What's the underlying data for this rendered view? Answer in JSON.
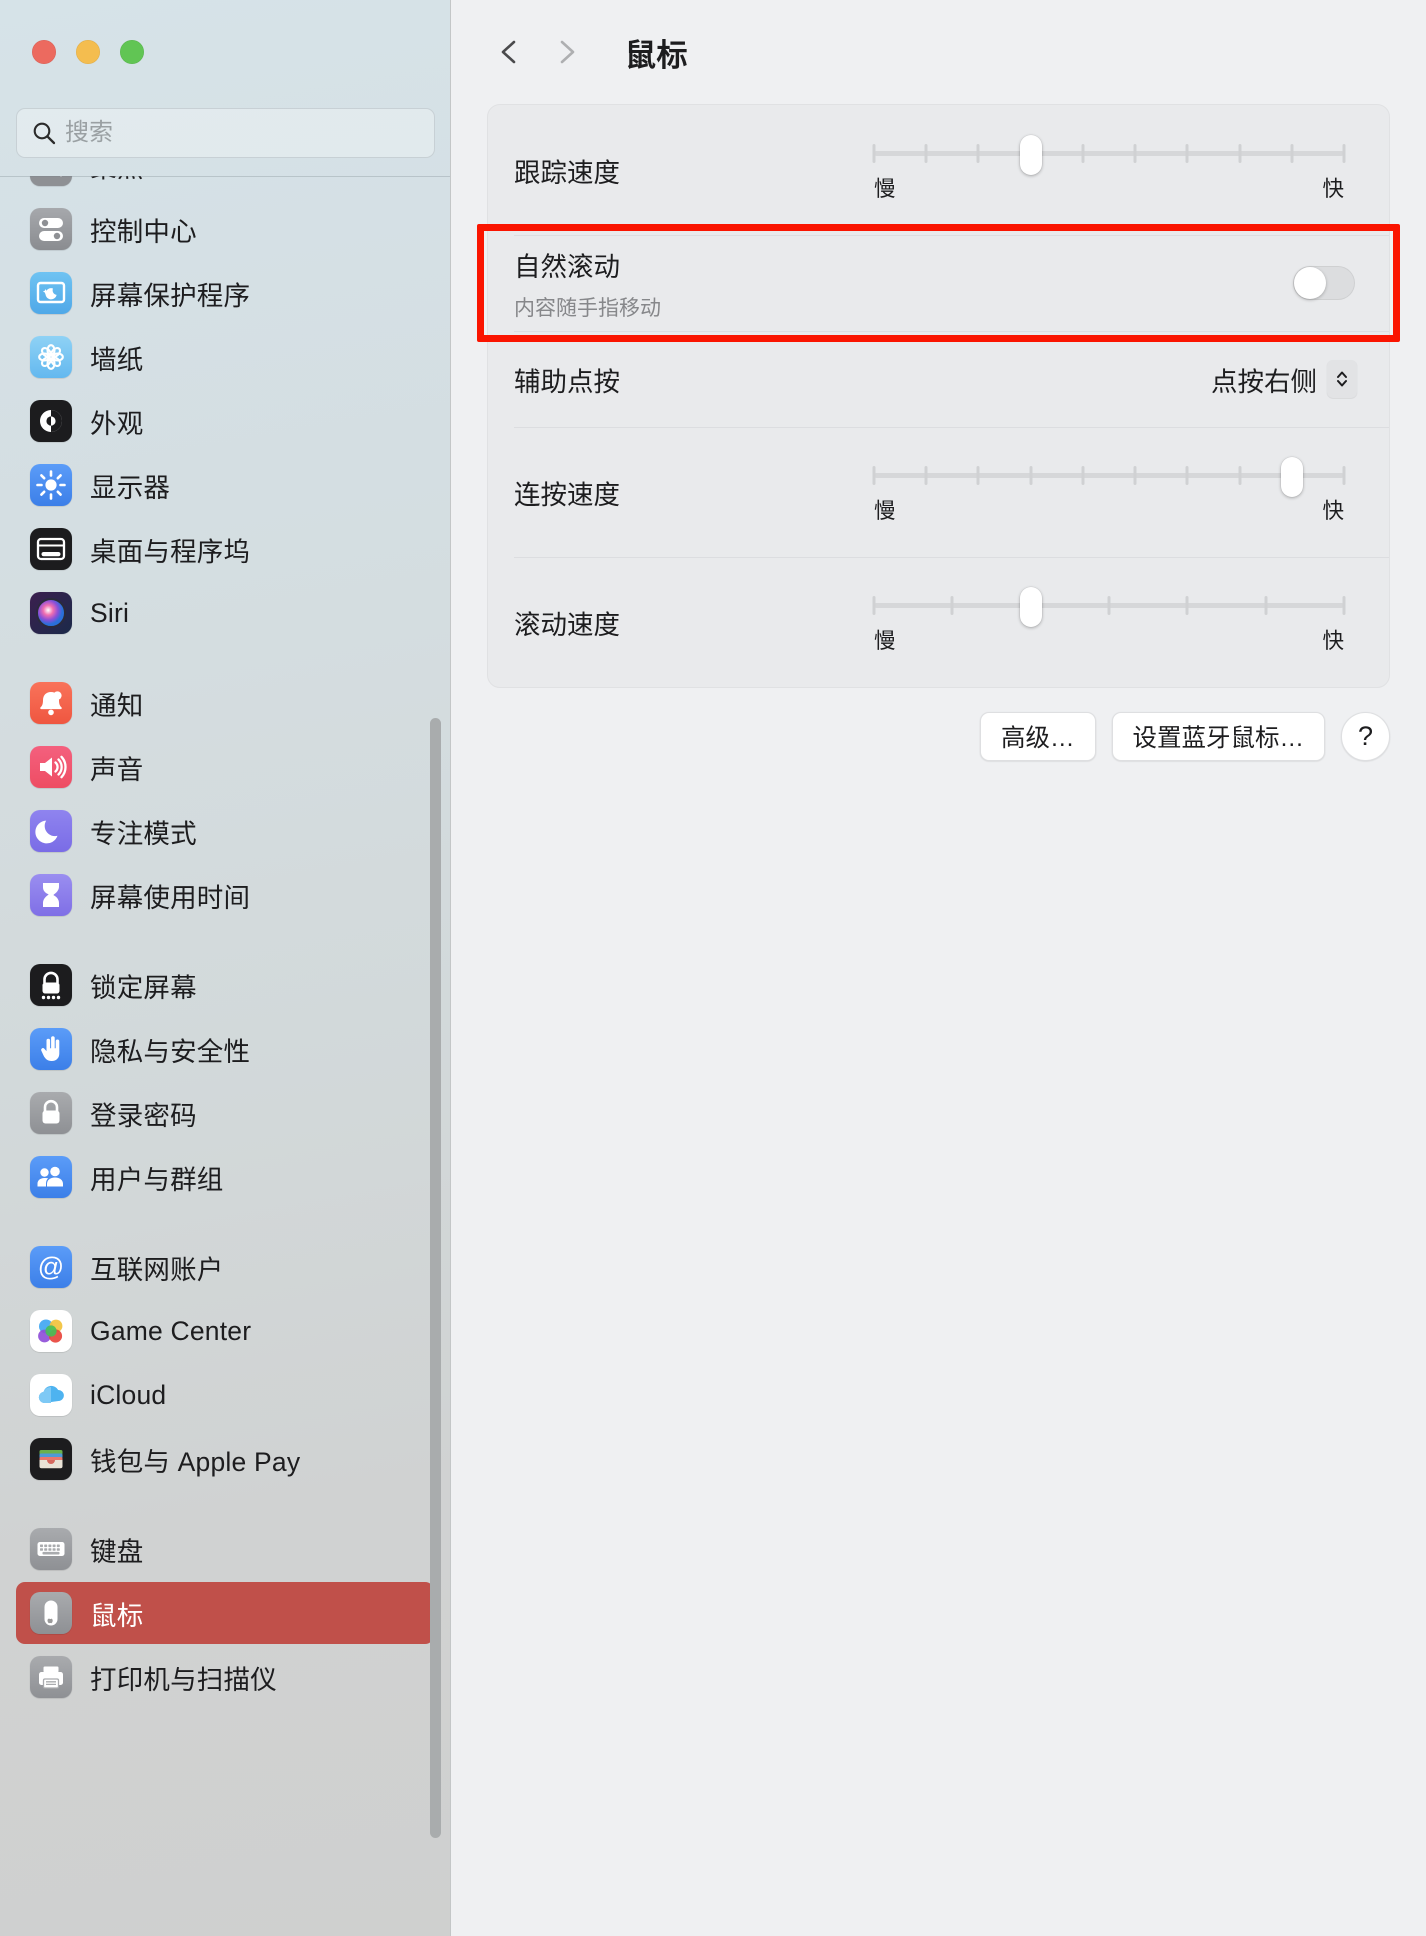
{
  "window": {
    "traffic_lights": [
      "close",
      "minimize",
      "zoom"
    ],
    "accent_color": "#c0504a"
  },
  "sidebar": {
    "search": {
      "placeholder": "搜索",
      "value": "",
      "icon": "search-icon"
    },
    "items": [
      {
        "label": "聚焦",
        "icon": "spotlight-icon",
        "clipped": true,
        "group": 0
      },
      {
        "label": "控制中心",
        "icon": "control-center-icon",
        "group": 0
      },
      {
        "label": "屏幕保护程序",
        "icon": "screen-saver-icon",
        "group": 0
      },
      {
        "label": "墙纸",
        "icon": "wallpaper-icon",
        "group": 0
      },
      {
        "label": "外观",
        "icon": "appearance-icon",
        "group": 0
      },
      {
        "label": "显示器",
        "icon": "displays-icon",
        "group": 0
      },
      {
        "label": "桌面与程序坞",
        "icon": "desktop-dock-icon",
        "group": 0
      },
      {
        "label": "Siri",
        "icon": "siri-icon",
        "group": 0
      },
      {
        "label": "通知",
        "icon": "notifications-icon",
        "group": 1
      },
      {
        "label": "声音",
        "icon": "sound-icon",
        "group": 1
      },
      {
        "label": "专注模式",
        "icon": "focus-icon",
        "group": 1
      },
      {
        "label": "屏幕使用时间",
        "icon": "screen-time-icon",
        "group": 1
      },
      {
        "label": "锁定屏幕",
        "icon": "lock-screen-icon",
        "group": 2
      },
      {
        "label": "隐私与安全性",
        "icon": "privacy-security-icon",
        "group": 2
      },
      {
        "label": "登录密码",
        "icon": "login-password-icon",
        "group": 2
      },
      {
        "label": "用户与群组",
        "icon": "users-groups-icon",
        "group": 2
      },
      {
        "label": "互联网账户",
        "icon": "internet-accounts-icon",
        "group": 3
      },
      {
        "label": "Game Center",
        "icon": "game-center-icon",
        "group": 3
      },
      {
        "label": "iCloud",
        "icon": "icloud-icon",
        "group": 3
      },
      {
        "label": "钱包与 Apple Pay",
        "icon": "wallet-apple-pay-icon",
        "group": 3
      },
      {
        "label": "键盘",
        "icon": "keyboard-icon",
        "group": 4
      },
      {
        "label": "鼠标",
        "icon": "mouse-icon",
        "group": 4,
        "selected": true
      },
      {
        "label": "打印机与扫描仪",
        "icon": "printers-scanners-icon",
        "group": 4
      }
    ]
  },
  "toolbar": {
    "back_icon": "chevron-left-icon",
    "forward_icon": "chevron-right-icon",
    "title": "鼠标"
  },
  "main": {
    "rows": [
      {
        "type": "slider",
        "label": "跟踪速度",
        "min_label": "慢",
        "max_label": "快",
        "ticks": 10,
        "value_index": 3
      },
      {
        "type": "toggle",
        "label": "自然滚动",
        "sublabel": "内容随手指移动",
        "state": "off",
        "highlighted": true
      },
      {
        "type": "popup",
        "label": "辅助点按",
        "value": "点按右侧",
        "chevron_icon": "chevron-up-down-icon"
      },
      {
        "type": "slider",
        "label": "连按速度",
        "min_label": "慢",
        "max_label": "快",
        "ticks": 10,
        "value_index": 8
      },
      {
        "type": "slider",
        "label": "滚动速度",
        "min_label": "慢",
        "max_label": "快",
        "ticks": 7,
        "value_index": 2
      }
    ],
    "buttons": [
      {
        "label": "高级…",
        "name": "advanced-button"
      },
      {
        "label": "设置蓝牙鼠标…",
        "name": "setup-bluetooth-mouse-button"
      },
      {
        "label": "?",
        "name": "help-button"
      }
    ]
  },
  "annotation": {
    "color": "#fa1400",
    "target": "自然滚动"
  }
}
